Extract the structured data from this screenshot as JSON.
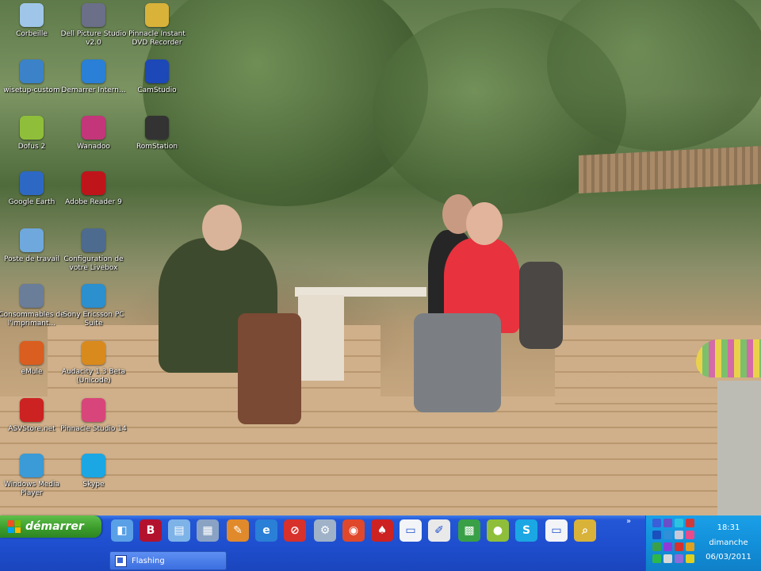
{
  "desktop": {
    "icons": [
      {
        "label": "Corbeille",
        "icon": "recycle-bin-icon",
        "color": "#9fc6e8"
      },
      {
        "label": "Dell Picture Studio v2.0",
        "icon": "photo-studio-icon",
        "color": "#6b6f88"
      },
      {
        "label": "Pinnacle Instant DVD Recorder",
        "icon": "dvd-recorder-icon",
        "color": "#d9b23a"
      },
      {
        "label": "wisetup-custom",
        "icon": "windows-setup-icon",
        "color": "#3b82c8"
      },
      {
        "label": "Demarrer Intern...",
        "icon": "internet-explorer-icon",
        "color": "#2a7fd6"
      },
      {
        "label": "CamStudio",
        "icon": "camstudio-icon",
        "color": "#1c48b8"
      },
      {
        "label": "Dofus 2",
        "icon": "dofus-egg-icon",
        "color": "#8fbf3a"
      },
      {
        "label": "Wanadoo",
        "icon": "wanadoo-icon",
        "color": "#c3367a"
      },
      {
        "label": "RomStation",
        "icon": "film-reel-icon",
        "color": "#333333"
      },
      {
        "label": "Google Earth",
        "icon": "globe-icon",
        "color": "#2d69c4"
      },
      {
        "label": "Adobe Reader 9",
        "icon": "pdf-icon",
        "color": "#c0141b"
      },
      {
        "label": "Poste de travail",
        "icon": "computer-icon",
        "color": "#6fa8dc"
      },
      {
        "label": "Configuration de votre Livebox",
        "icon": "livebox-icon",
        "color": "#4d6b8f"
      },
      {
        "label": "Consommables de l'imprimant...",
        "icon": "printer-icon",
        "color": "#6a7d99"
      },
      {
        "label": "Sony Ericsson PC Suite",
        "icon": "phone-suite-icon",
        "color": "#2c8fce"
      },
      {
        "label": "eMule",
        "icon": "emule-icon",
        "color": "#d95e1f"
      },
      {
        "label": "Audacity 1.3 Beta (Unicode)",
        "icon": "headphones-icon",
        "color": "#d98a1c"
      },
      {
        "label": "ASVStore.net",
        "icon": "asvstore-icon",
        "color": "#cc2222"
      },
      {
        "label": "Pinnacle Studio 14",
        "icon": "pinnacle-studio-icon",
        "color": "#d8457a"
      },
      {
        "label": "Windows Media Player",
        "icon": "media-player-icon",
        "color": "#3a9bd6"
      },
      {
        "label": "Skype",
        "icon": "skype-icon",
        "color": "#1aa7e3"
      }
    ]
  },
  "taskbar": {
    "start_label": "démarrer",
    "quicklaunch": [
      {
        "icon": "show-desktop-icon",
        "color": "#5aa0e6",
        "glyph": "◧"
      },
      {
        "icon": "bold-b-icon",
        "color": "#b3122e",
        "glyph": "B"
      },
      {
        "icon": "notepad-icon",
        "color": "#7eb3e8",
        "glyph": "▤"
      },
      {
        "icon": "calculator-icon",
        "color": "#8aa3c4",
        "glyph": "▦"
      },
      {
        "icon": "paint-icon",
        "color": "#e08a2b",
        "glyph": "✎"
      },
      {
        "icon": "internet-explorer-icon",
        "color": "#2a7fd6",
        "glyph": "e"
      },
      {
        "icon": "no-entry-icon",
        "color": "#d8302b",
        "glyph": "⊘"
      },
      {
        "icon": "network-icon",
        "color": "#9fb2c8",
        "glyph": "⚙"
      },
      {
        "icon": "cd-burner-icon",
        "color": "#e0482c",
        "glyph": "◉"
      },
      {
        "icon": "asvstore-icon",
        "color": "#cc2222",
        "glyph": "♠"
      },
      {
        "icon": "window-icon",
        "color": "#f2f4f8",
        "glyph": "▭"
      },
      {
        "icon": "edit-document-icon",
        "color": "#e9e9e9",
        "glyph": "✐"
      },
      {
        "icon": "color-grid-icon",
        "color": "#3aa047",
        "glyph": "▩"
      },
      {
        "icon": "dofus-egg-icon",
        "color": "#8fbf3a",
        "glyph": "●"
      },
      {
        "icon": "skype-icon",
        "color": "#1aa7e3",
        "glyph": "S"
      },
      {
        "icon": "window-icon",
        "color": "#f2f4f8",
        "glyph": "▭"
      },
      {
        "icon": "search-magnifier-icon",
        "color": "#d9b23a",
        "glyph": "⌕"
      }
    ],
    "overflow_chevron": "»",
    "tasks": [
      {
        "label": "Flashing",
        "icon": "window-icon"
      }
    ]
  },
  "tray": {
    "time": "18:31",
    "day": "dimanche",
    "date": "06/03/2011",
    "icon_colors": [
      "#3a5fd8",
      "#6a4fc8",
      "#2cc3e0",
      "#d23a3a",
      "#1a4fbd",
      "#2f8fd8",
      "#c8c8d8",
      "#e84a8a",
      "#3aa047",
      "#8f3ad8",
      "#d8302b",
      "#e0a020",
      "#2fb84a",
      "#d8d8d8",
      "#8f6ad8",
      "#e0d020"
    ]
  }
}
